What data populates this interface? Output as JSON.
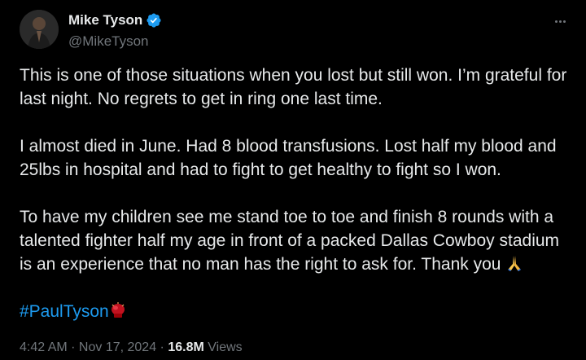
{
  "author": {
    "name": "Mike Tyson",
    "handle": "@MikeTyson",
    "verified": true,
    "avatar_icon": "praying-man-avatar",
    "badge_color": "#1d9bf0"
  },
  "more_icon": "ellipsis-icon",
  "body": {
    "paragraph1": [
      "This is one of those situations when you lost but still won. I’m grateful for",
      "last night.  No regrets to get in ring one last time."
    ],
    "paragraph2": [
      "I almost died in June. Had 8 blood transfusions. Lost half my blood and",
      "25lbs in hospital and had to fight to get healthy to fight so I won."
    ],
    "paragraph3": [
      "To have my children see me stand toe to toe and finish 8 rounds with a",
      "talented fighter half my age in front of a packed Dallas Cowboy stadium",
      "is an experience that no man has the right to ask for.  Thank you "
    ],
    "thank_emoji": "folded-hands-icon"
  },
  "hashtag": {
    "text": "#PaulTyson",
    "emoji": "boxing-glove-icon",
    "color": "#1d9bf0"
  },
  "meta": {
    "time": "4:42 AM",
    "separator1": " · ",
    "date": "Nov 17, 2024",
    "separator2": " · ",
    "views_count": "16.8M",
    "views_label": "Views"
  },
  "colors": {
    "background": "#000000",
    "text": "#e7e9ea",
    "secondary": "#71767b",
    "link": "#1d9bf0"
  }
}
